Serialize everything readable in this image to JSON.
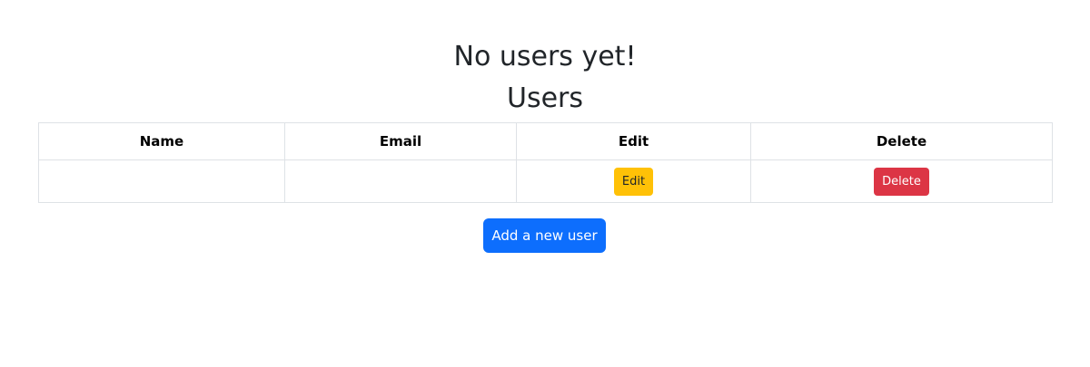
{
  "headings": {
    "empty_message": "No users yet!",
    "title": "Users"
  },
  "table": {
    "columns": [
      "Name",
      "Email",
      "Edit",
      "Delete"
    ],
    "rows": [
      {
        "name": "",
        "email": "",
        "edit_label": "Edit",
        "delete_label": "Delete"
      }
    ]
  },
  "actions": {
    "add_label": "Add a new user"
  },
  "colors": {
    "primary": "#0d6efd",
    "warning": "#ffc107",
    "danger": "#dc3545",
    "border": "#dee2e6"
  }
}
